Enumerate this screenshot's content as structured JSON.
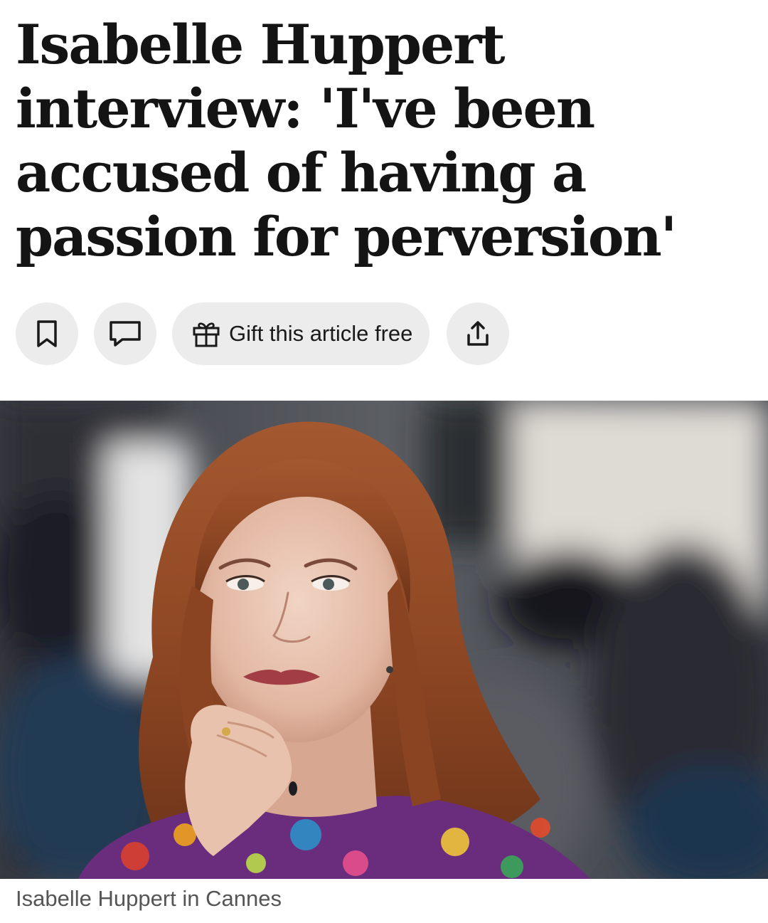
{
  "article": {
    "headline": "Isabelle Huppert interview: 'I've been accused of having a passion for perversion'",
    "image_caption": "Isabelle Huppert in Cannes"
  },
  "actions": {
    "bookmark_icon": "bookmark-icon",
    "comment_icon": "comment-icon",
    "gift_icon": "gift-icon",
    "gift_label": "Gift this article free",
    "share_icon": "share-icon"
  },
  "colors": {
    "text": "#141414",
    "button_bg": "#ececec",
    "caption": "#555555"
  }
}
